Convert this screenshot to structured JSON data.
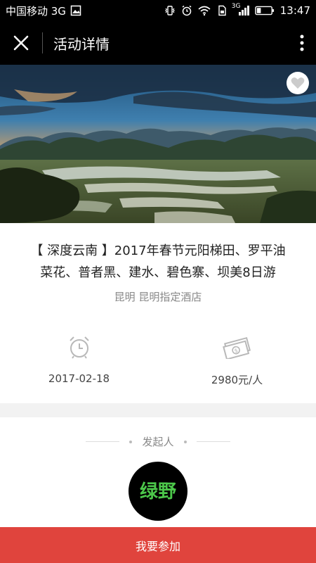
{
  "statusbar": {
    "carrier": "中国移动 3G",
    "net_small": "3G",
    "time": "13:47"
  },
  "titlebar": {
    "title": "活动详情",
    "close_icon": "close-icon",
    "more_icon": "more-vertical-icon"
  },
  "hero": {
    "image_subject": "Yunnan terraced fields landscape at dusk",
    "favorite_icon": "heart-icon"
  },
  "event": {
    "title": "【 深度云南 】2017年春节元阳梯田、罗平油菜花、普者黑、建水、碧色寨、坝美8日游",
    "location": "昆明 昆明指定酒店",
    "date": "2017-02-18",
    "price": "2980元/人",
    "date_icon": "alarm-clock-icon",
    "price_icon": "money-icon"
  },
  "organizer": {
    "label": "发起人",
    "logo_text": "绿野"
  },
  "action": {
    "join_label": "我要参加"
  },
  "colors": {
    "accent": "#e0443d",
    "logo_green": "#4cc74a"
  }
}
